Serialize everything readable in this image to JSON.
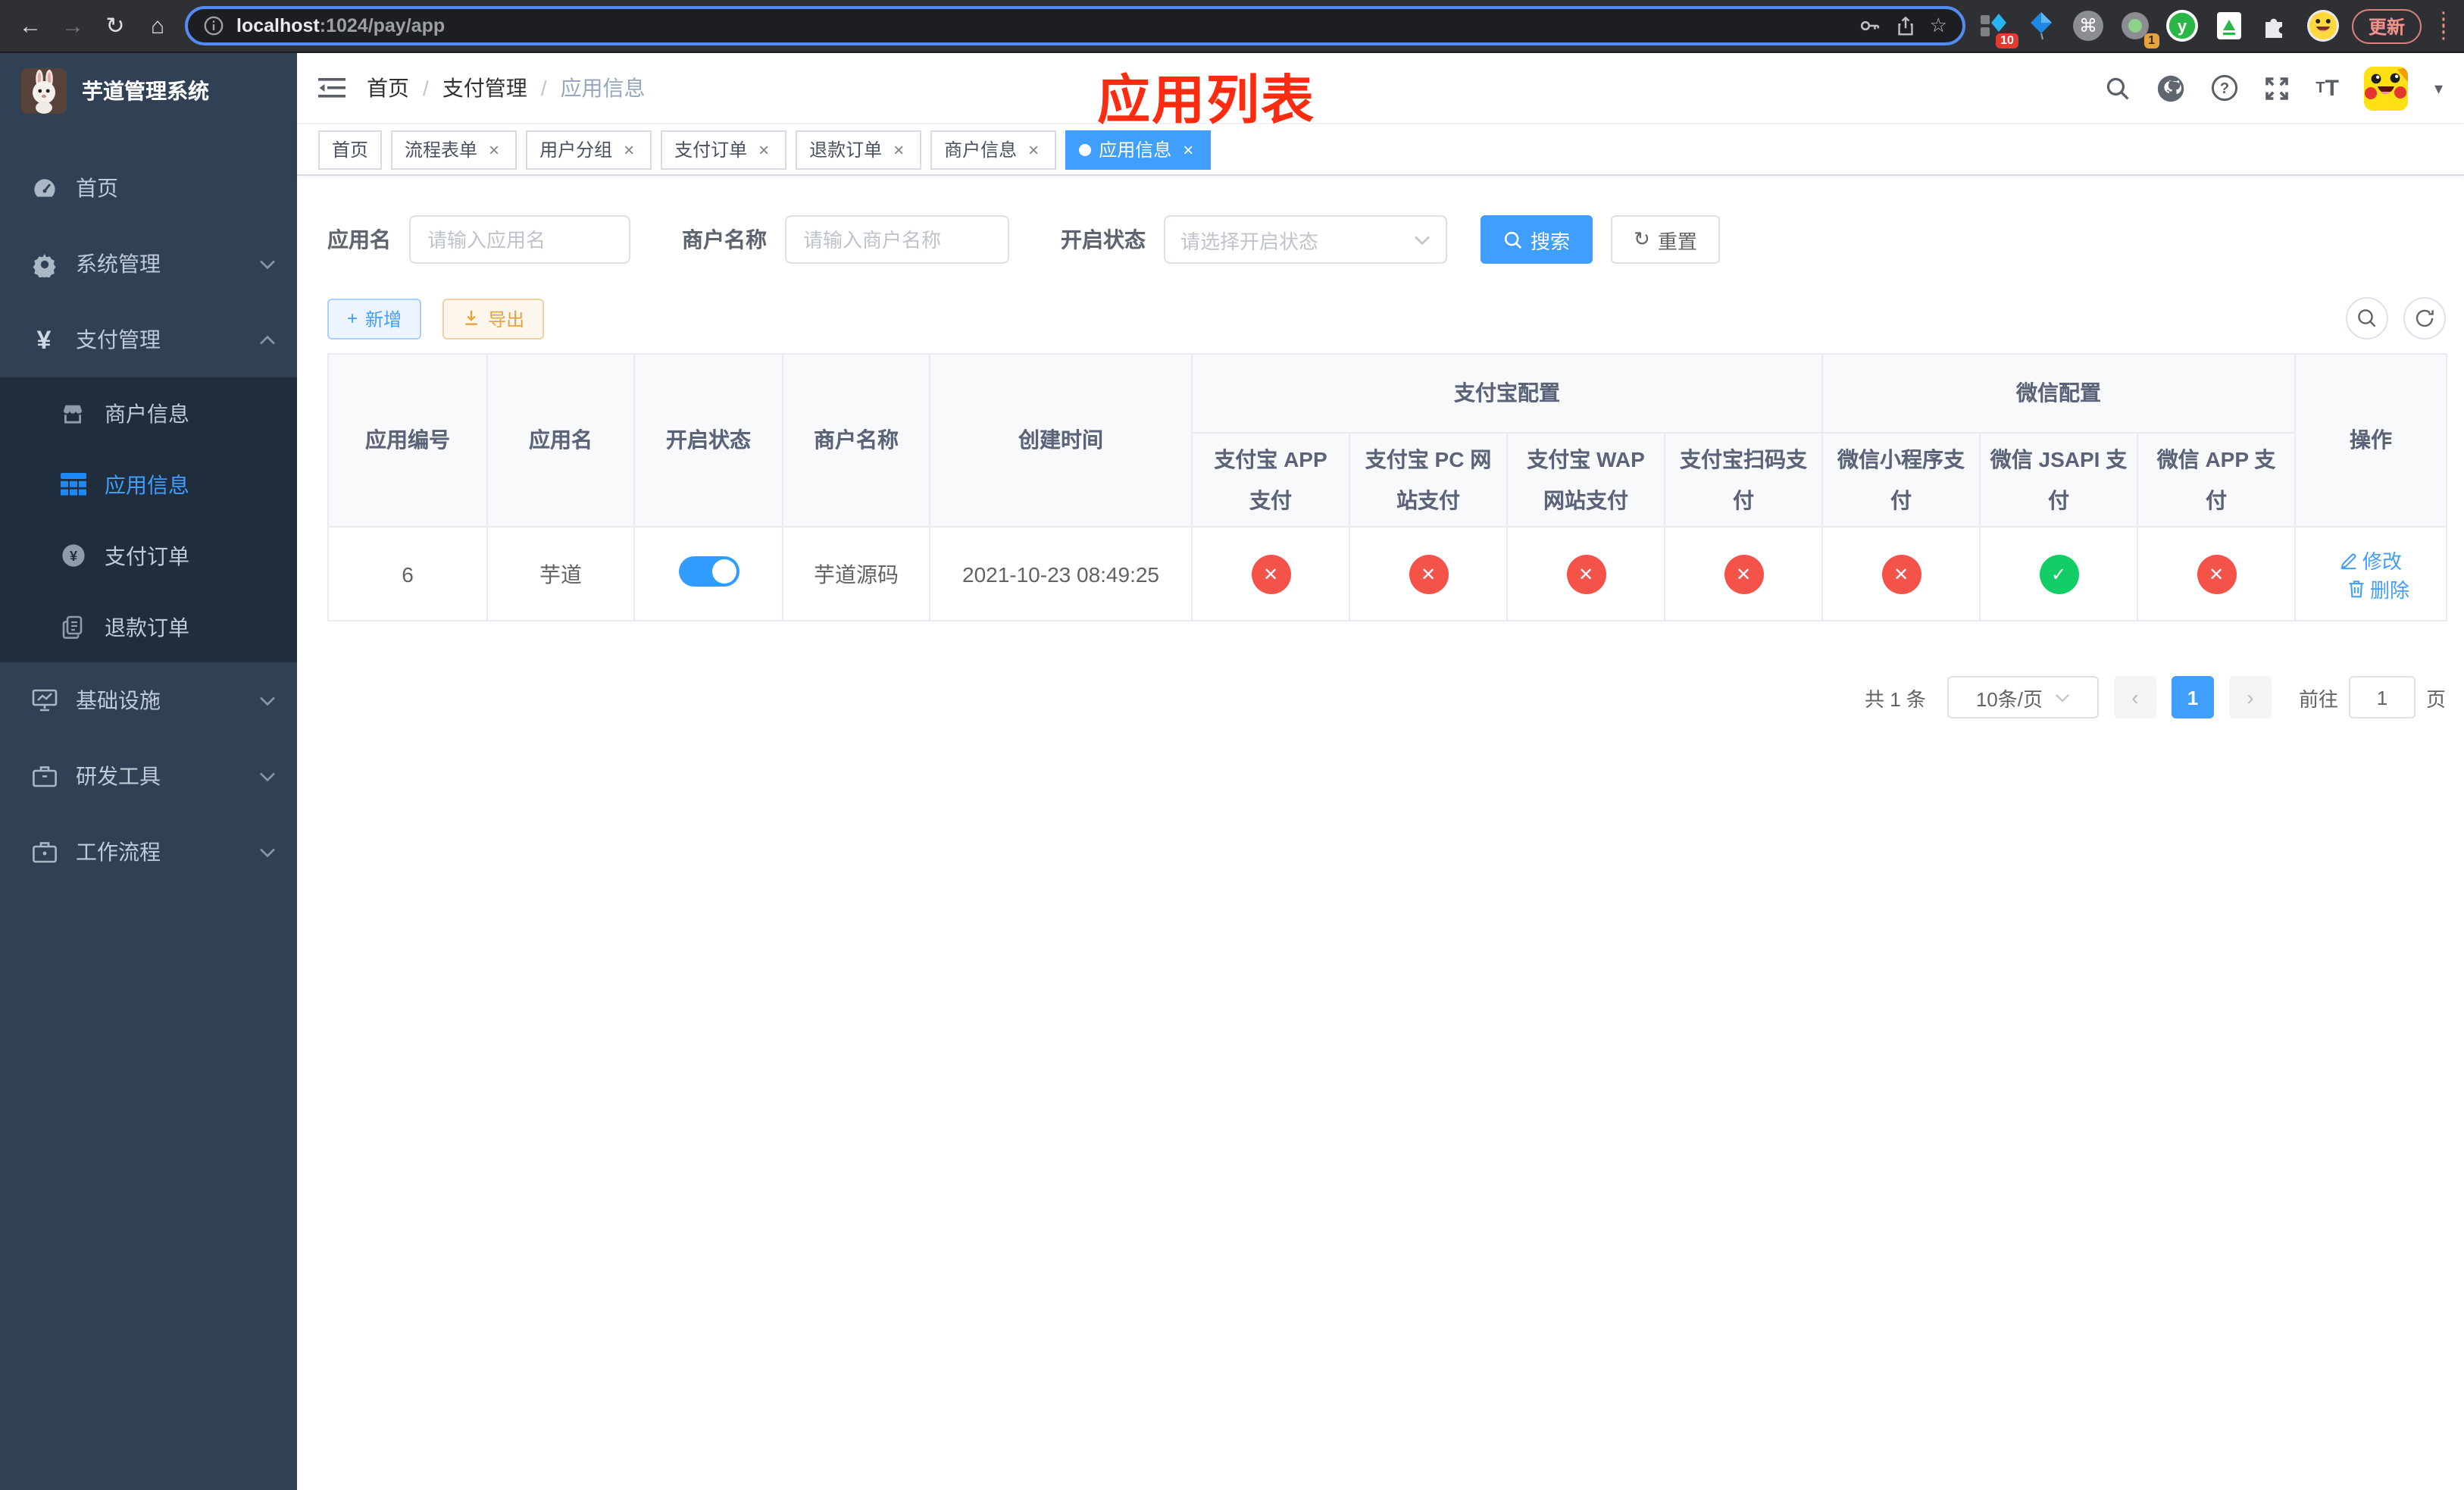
{
  "browser": {
    "url_host": "localhost",
    "url_rest": ":1024/pay/app",
    "update_label": "更新",
    "ext_badge_1": "10",
    "ext_badge_2": "1"
  },
  "sidebar": {
    "title": "芋道管理系统",
    "menu": [
      {
        "label": "首页",
        "active": false
      },
      {
        "label": "系统管理",
        "active": false
      },
      {
        "label": "支付管理",
        "active": false
      },
      {
        "label": "商户信息",
        "active": false
      },
      {
        "label": "应用信息",
        "active": true
      },
      {
        "label": "支付订单",
        "active": false
      },
      {
        "label": "退款订单",
        "active": false
      },
      {
        "label": "基础设施",
        "active": false
      },
      {
        "label": "研发工具",
        "active": false
      },
      {
        "label": "工作流程",
        "active": false
      }
    ]
  },
  "header": {
    "breadcrumb": [
      "首页",
      "支付管理",
      "应用信息"
    ],
    "annotation": "应用列表"
  },
  "tags": [
    {
      "label": "首页",
      "closable": false,
      "active": false
    },
    {
      "label": "流程表单",
      "closable": true,
      "active": false
    },
    {
      "label": "用户分组",
      "closable": true,
      "active": false
    },
    {
      "label": "支付订单",
      "closable": true,
      "active": false
    },
    {
      "label": "退款订单",
      "closable": true,
      "active": false
    },
    {
      "label": "商户信息",
      "closable": true,
      "active": false
    },
    {
      "label": "应用信息",
      "closable": true,
      "active": true
    }
  ],
  "filters": {
    "app_name_label": "应用名",
    "app_name_placeholder": "请输入应用名",
    "merchant_label": "商户名称",
    "merchant_placeholder": "请输入商户名称",
    "status_label": "开启状态",
    "status_placeholder": "请选择开启状态",
    "search_label": "搜索",
    "reset_label": "重置"
  },
  "toolbar": {
    "add_label": "新增",
    "export_label": "导出"
  },
  "table": {
    "columns": [
      "应用编号",
      "应用名",
      "开启状态",
      "商户名称",
      "创建时间"
    ],
    "groups": [
      {
        "label": "支付宝配置",
        "children": [
          "支付宝 APP 支付",
          "支付宝 PC 网站支付",
          "支付宝 WAP 网站支付",
          "支付宝扫码支付"
        ]
      },
      {
        "label": "微信配置",
        "children": [
          "微信小程序支付",
          "微信 JSAPI 支付",
          "微信 APP 支付"
        ]
      }
    ],
    "actions_label": "操作",
    "rows": [
      {
        "id": "6",
        "name": "芋道",
        "enabled": true,
        "merchant": "芋道源码",
        "created": "2021-10-23 08:49:25",
        "statuses": [
          "closed",
          "closed",
          "closed",
          "closed",
          "closed",
          "open",
          "closed"
        ],
        "edit_label": "修改",
        "delete_label": "删除"
      }
    ]
  },
  "pagination": {
    "total": "共 1 条",
    "page_size": "10条/页",
    "current": "1",
    "goto_label": "前往",
    "goto_value": "1",
    "page_label": "页"
  },
  "colors": {
    "primary": "#409eff",
    "danger": "#f4534a",
    "success": "#13ce66",
    "warning": "#e6a23c",
    "sidebar_bg": "#304156",
    "submenu_bg": "#1f2d3d",
    "annotation_red": "#fd2b10"
  }
}
